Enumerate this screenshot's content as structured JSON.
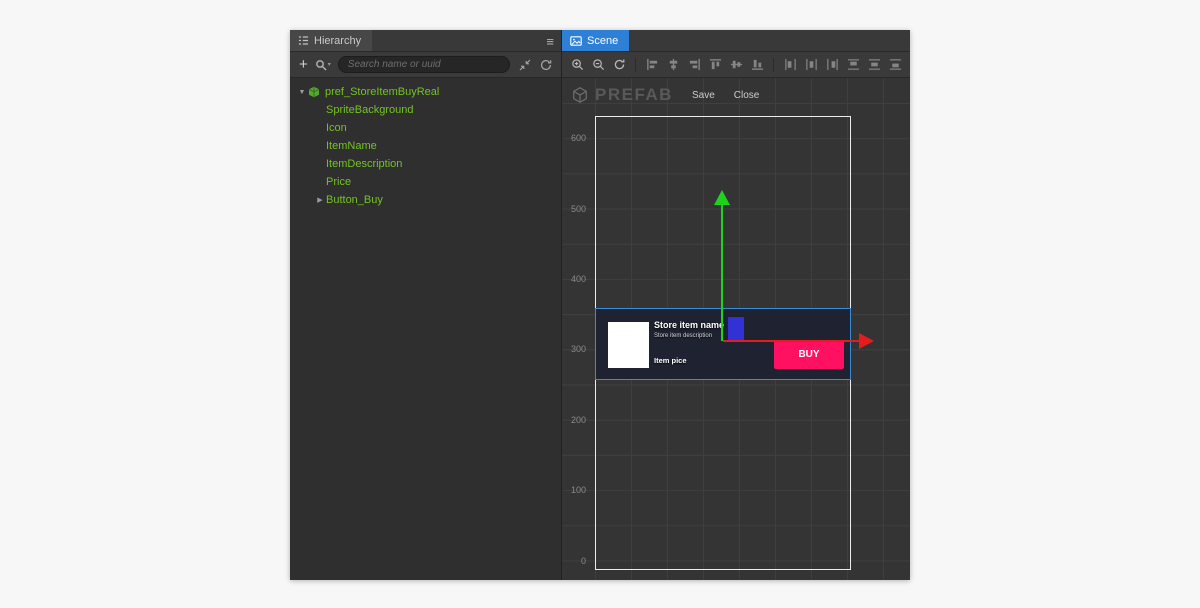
{
  "glyphs": {
    "plus": "+",
    "caret_down": "▾",
    "menu": "≡",
    "twisty_open": "▼",
    "twisty_closed": "▶"
  },
  "hierarchy": {
    "tab_label": "Hierarchy",
    "search_placeholder": "Search name or uuid",
    "tree": {
      "root": {
        "label": "pref_StoreItemBuyReal",
        "expanded": true
      },
      "children": [
        {
          "label": "SpriteBackground"
        },
        {
          "label": "Icon"
        },
        {
          "label": "ItemName"
        },
        {
          "label": "ItemDescription"
        },
        {
          "label": "Price"
        },
        {
          "label": "Button_Buy",
          "has_children": true
        }
      ]
    }
  },
  "scene": {
    "tab_label": "Scene",
    "prefab_bar": {
      "title": "PREFAB",
      "save_label": "Save",
      "close_label": "Close"
    },
    "ruler": [
      "600",
      "500",
      "400",
      "300",
      "200",
      "100",
      "0"
    ],
    "store_item": {
      "name": "Store item name",
      "description": "Store item description",
      "price": "Item pice",
      "buy_label": "BUY"
    },
    "colors": {
      "selection_outline": "#3c8bd9",
      "buy_button": "#ff1060",
      "axis_x": "#e41c1c",
      "axis_y": "#1ed31e",
      "axis_plane": "#3131d6",
      "tree_text": "#73c322",
      "scene_tab": "#2d80d6"
    }
  }
}
